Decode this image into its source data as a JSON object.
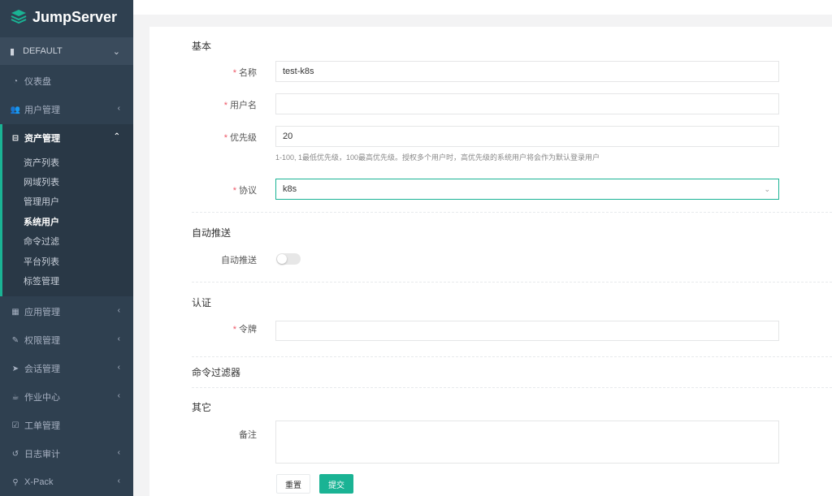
{
  "app": {
    "logo_text": "JumpServer"
  },
  "org": {
    "label": "DEFAULT"
  },
  "sidebar": {
    "items": [
      {
        "label": "仪表盘",
        "icon": "dashboard-icon"
      },
      {
        "label": "用户管理",
        "icon": "users-icon"
      },
      {
        "label": "资产管理",
        "icon": "inbox-icon"
      },
      {
        "label": "应用管理",
        "icon": "grid-icon"
      },
      {
        "label": "权限管理",
        "icon": "edit-icon"
      },
      {
        "label": "会话管理",
        "icon": "rocket-icon"
      },
      {
        "label": "作业中心",
        "icon": "coffee-icon"
      },
      {
        "label": "工单管理",
        "icon": "check-square-icon"
      },
      {
        "label": "日志审计",
        "icon": "history-icon"
      },
      {
        "label": "X-Pack",
        "icon": "sitemap-icon"
      }
    ],
    "asset_sub": [
      "资产列表",
      "网域列表",
      "管理用户",
      "系统用户",
      "命令过滤",
      "平台列表",
      "标签管理"
    ]
  },
  "form": {
    "section_basic": "基本",
    "name_label": "名称",
    "name_value": "test-k8s",
    "username_label": "用户名",
    "username_value": "",
    "priority_label": "优先级",
    "priority_value": "20",
    "priority_help": "1-100, 1最低优先级，100最高优先级。授权多个用户时，高优先级的系统用户将会作为默认登录用户",
    "protocol_label": "协议",
    "protocol_value": "k8s",
    "section_autopush": "自动推送",
    "autopush_label": "自动推送",
    "autopush_on": false,
    "section_auth": "认证",
    "token_label": "令牌",
    "token_value": "",
    "section_cmdfilter": "命令过滤器",
    "section_other": "其它",
    "comment_label": "备注",
    "comment_value": "",
    "reset_label": "重置",
    "submit_label": "提交"
  },
  "colors": {
    "sidebar": "#2f4050",
    "accent": "#1ab394",
    "required": "#ed5565"
  }
}
